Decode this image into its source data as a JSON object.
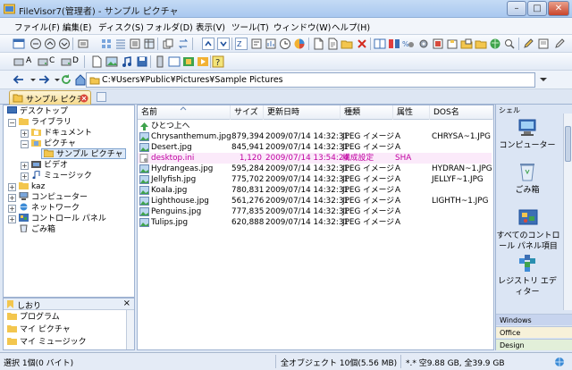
{
  "window": {
    "title": "FileVisor7(管理者) - サンプル ピクチャ",
    "min_label": "–",
    "max_label": "□",
    "close_label": "✕"
  },
  "menu": [
    "ファイル(F)",
    "編集(E)",
    "ディスク(S)",
    "フォルダ(D)",
    "表示(V)",
    "ツール(T)",
    "ウィンドウ(W)",
    "ヘルプ(H)"
  ],
  "drives": [
    "A",
    "C",
    "D"
  ],
  "address": {
    "path": "C:¥Users¥Public¥Pictures¥Sample Pictures"
  },
  "tab": {
    "label": "サンプル ピクチャ"
  },
  "tree": [
    {
      "label": "デスクトップ"
    },
    {
      "label": "ライブラリ"
    },
    {
      "label": "ドキュメント"
    },
    {
      "label": "ピクチャ"
    },
    {
      "label": "サンプル ピクチャ"
    },
    {
      "label": "ビデオ"
    },
    {
      "label": "ミュージック"
    },
    {
      "label": "kaz"
    },
    {
      "label": "コンピューター"
    },
    {
      "label": "ネットワーク"
    },
    {
      "label": "コントロール パネル"
    },
    {
      "label": "ごみ箱"
    }
  ],
  "bookmarks": {
    "title": "しおり",
    "items": [
      "プログラム",
      "マイ ピクチャ",
      "マイ ミュージック"
    ]
  },
  "file_list": {
    "columns": [
      "名前",
      "サイズ",
      "更新日時",
      "種類",
      "属性",
      "DOS名"
    ],
    "up_label": "ひとつ上へ",
    "rows": [
      {
        "name": "Chrysanthemum.jpg",
        "size": "879,394",
        "date": "2009/07/14 14:32:31",
        "type": "JPEG イメージ",
        "attr": "A",
        "dos": "CHRYSA~1.JPG"
      },
      {
        "name": "Desert.jpg",
        "size": "845,941",
        "date": "2009/07/14 14:32:31",
        "type": "JPEG イメージ",
        "attr": "A",
        "dos": ""
      },
      {
        "name": "desktop.ini",
        "size": "1,120",
        "date": "2009/07/14 13:54:24",
        "type": "構成設定",
        "attr": "SHA",
        "dos": ""
      },
      {
        "name": "Hydrangeas.jpg",
        "size": "595,284",
        "date": "2009/07/14 14:32:31",
        "type": "JPEG イメージ",
        "attr": "A",
        "dos": "HYDRAN~1.JPG"
      },
      {
        "name": "Jellyfish.jpg",
        "size": "775,702",
        "date": "2009/07/14 14:32:31",
        "type": "JPEG イメージ",
        "attr": "A",
        "dos": "JELLYF~1.JPG"
      },
      {
        "name": "Koala.jpg",
        "size": "780,831",
        "date": "2009/07/14 14:32:31",
        "type": "JPEG イメージ",
        "attr": "A",
        "dos": ""
      },
      {
        "name": "Lighthouse.jpg",
        "size": "561,276",
        "date": "2009/07/14 14:32:31",
        "type": "JPEG イメージ",
        "attr": "A",
        "dos": "LIGHTH~1.JPG"
      },
      {
        "name": "Penguins.jpg",
        "size": "777,835",
        "date": "2009/07/14 14:32:31",
        "type": "JPEG イメージ",
        "attr": "A",
        "dos": ""
      },
      {
        "name": "Tulips.jpg",
        "size": "620,888",
        "date": "2009/07/14 14:32:31",
        "type": "JPEG イメージ",
        "attr": "A",
        "dos": ""
      }
    ]
  },
  "shell_panel": {
    "title": "シェル",
    "shortcuts": [
      {
        "label": "コンピューター",
        "icon": "computer-icon"
      },
      {
        "label": "ごみ箱",
        "icon": "recycle-bin-icon"
      },
      {
        "label": "すべてのコントロール パネル項目",
        "icon": "control-panel-icon"
      },
      {
        "label": "レジストリ エディター",
        "icon": "registry-editor-icon"
      }
    ],
    "groups": [
      "Windows",
      "Office",
      "Design"
    ]
  },
  "status": {
    "selection": "選択 1個(0 バイト)",
    "total": "全オブジェクト 10個(5.56 MB)",
    "free": "*.* 空9.88 GB, 全39.9 GB"
  },
  "colors": {
    "accent": "#3c6fb4",
    "hidden_file": "#c000a0",
    "title_grad": "#a9c8ef"
  }
}
